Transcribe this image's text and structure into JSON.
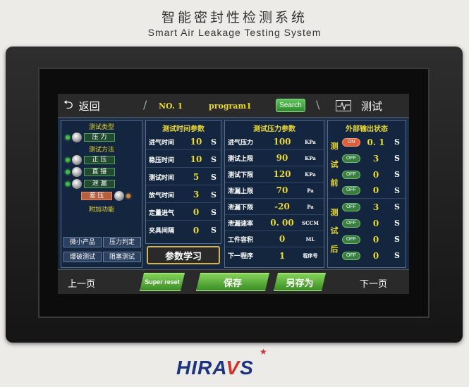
{
  "device": {
    "title_cn": "智能密封性检测系统",
    "title_en": "Smart Air Leakage Testing System",
    "logo_text": "HIRAVS"
  },
  "topbar": {
    "back_label": "返回",
    "program_no": "NO. 1",
    "program_name": "program1",
    "search_label": "Search",
    "test_label": "测试"
  },
  "left": {
    "test_type_title": "测试类型",
    "test_type": "压 力",
    "test_method_title": "测试方法",
    "methods": [
      "正 压",
      "直 接",
      "泄 漏"
    ],
    "diff_label": "差 压",
    "addon_title": "附加功能",
    "addons": [
      "微小产品",
      "压力判定",
      "爆破测试",
      "阻塞测试"
    ],
    "learn_label": "参数学习"
  },
  "time_panel": {
    "title": "测试时间参数",
    "rows": [
      {
        "label": "进气时间",
        "value": "10",
        "unit": "S"
      },
      {
        "label": "稳压时间",
        "value": "10",
        "unit": "S"
      },
      {
        "label": "测试时间",
        "value": "5",
        "unit": "S"
      },
      {
        "label": "放气时间",
        "value": "3",
        "unit": "S"
      },
      {
        "label": "定量进气",
        "value": "0",
        "unit": "S"
      },
      {
        "label": "夹具间隔",
        "value": "0",
        "unit": "S"
      }
    ]
  },
  "pressure_panel": {
    "title": "测试压力参数",
    "rows": [
      {
        "label": "进气压力",
        "value": "100",
        "unit": "KPa"
      },
      {
        "label": "测试上限",
        "value": "90",
        "unit": "KPa"
      },
      {
        "label": "测试下限",
        "value": "120",
        "unit": "KPa"
      },
      {
        "label": "泄漏上限",
        "value": "70",
        "unit": "Pa"
      },
      {
        "label": "泄漏下限",
        "value": "-20",
        "unit": "Pa"
      },
      {
        "label": "泄漏速率",
        "value": "0. 00",
        "unit": "SCCM"
      },
      {
        "label": "工件容积",
        "value": "0",
        "unit": "ML"
      },
      {
        "label": "下一程序",
        "value": "1",
        "unit": "程序号"
      }
    ]
  },
  "output_panel": {
    "title": "外部输出状态",
    "before_tag": "测试前",
    "after_tag": "测试后",
    "rows": [
      {
        "state": "ON",
        "value": "0. 1",
        "unit": "S"
      },
      {
        "state": "OFF",
        "value": "3",
        "unit": "S"
      },
      {
        "state": "OFF",
        "value": "0",
        "unit": "S"
      },
      {
        "state": "OFF",
        "value": "0",
        "unit": "S"
      },
      {
        "state": "OFF",
        "value": "3",
        "unit": "S"
      },
      {
        "state": "OFF",
        "value": "0",
        "unit": "S"
      },
      {
        "state": "OFF",
        "value": "0",
        "unit": "S"
      },
      {
        "state": "OFF",
        "value": "0",
        "unit": "S"
      }
    ]
  },
  "bottombar": {
    "prev_label": "上一页",
    "reset_label": "Super reset",
    "save_label": "保存",
    "save_as_label": "另存为",
    "next_label": "下一页"
  },
  "colors": {
    "accent_yellow": "#e8d830",
    "button_green": "#5ec55a",
    "on_orange": "#e05f3a"
  }
}
